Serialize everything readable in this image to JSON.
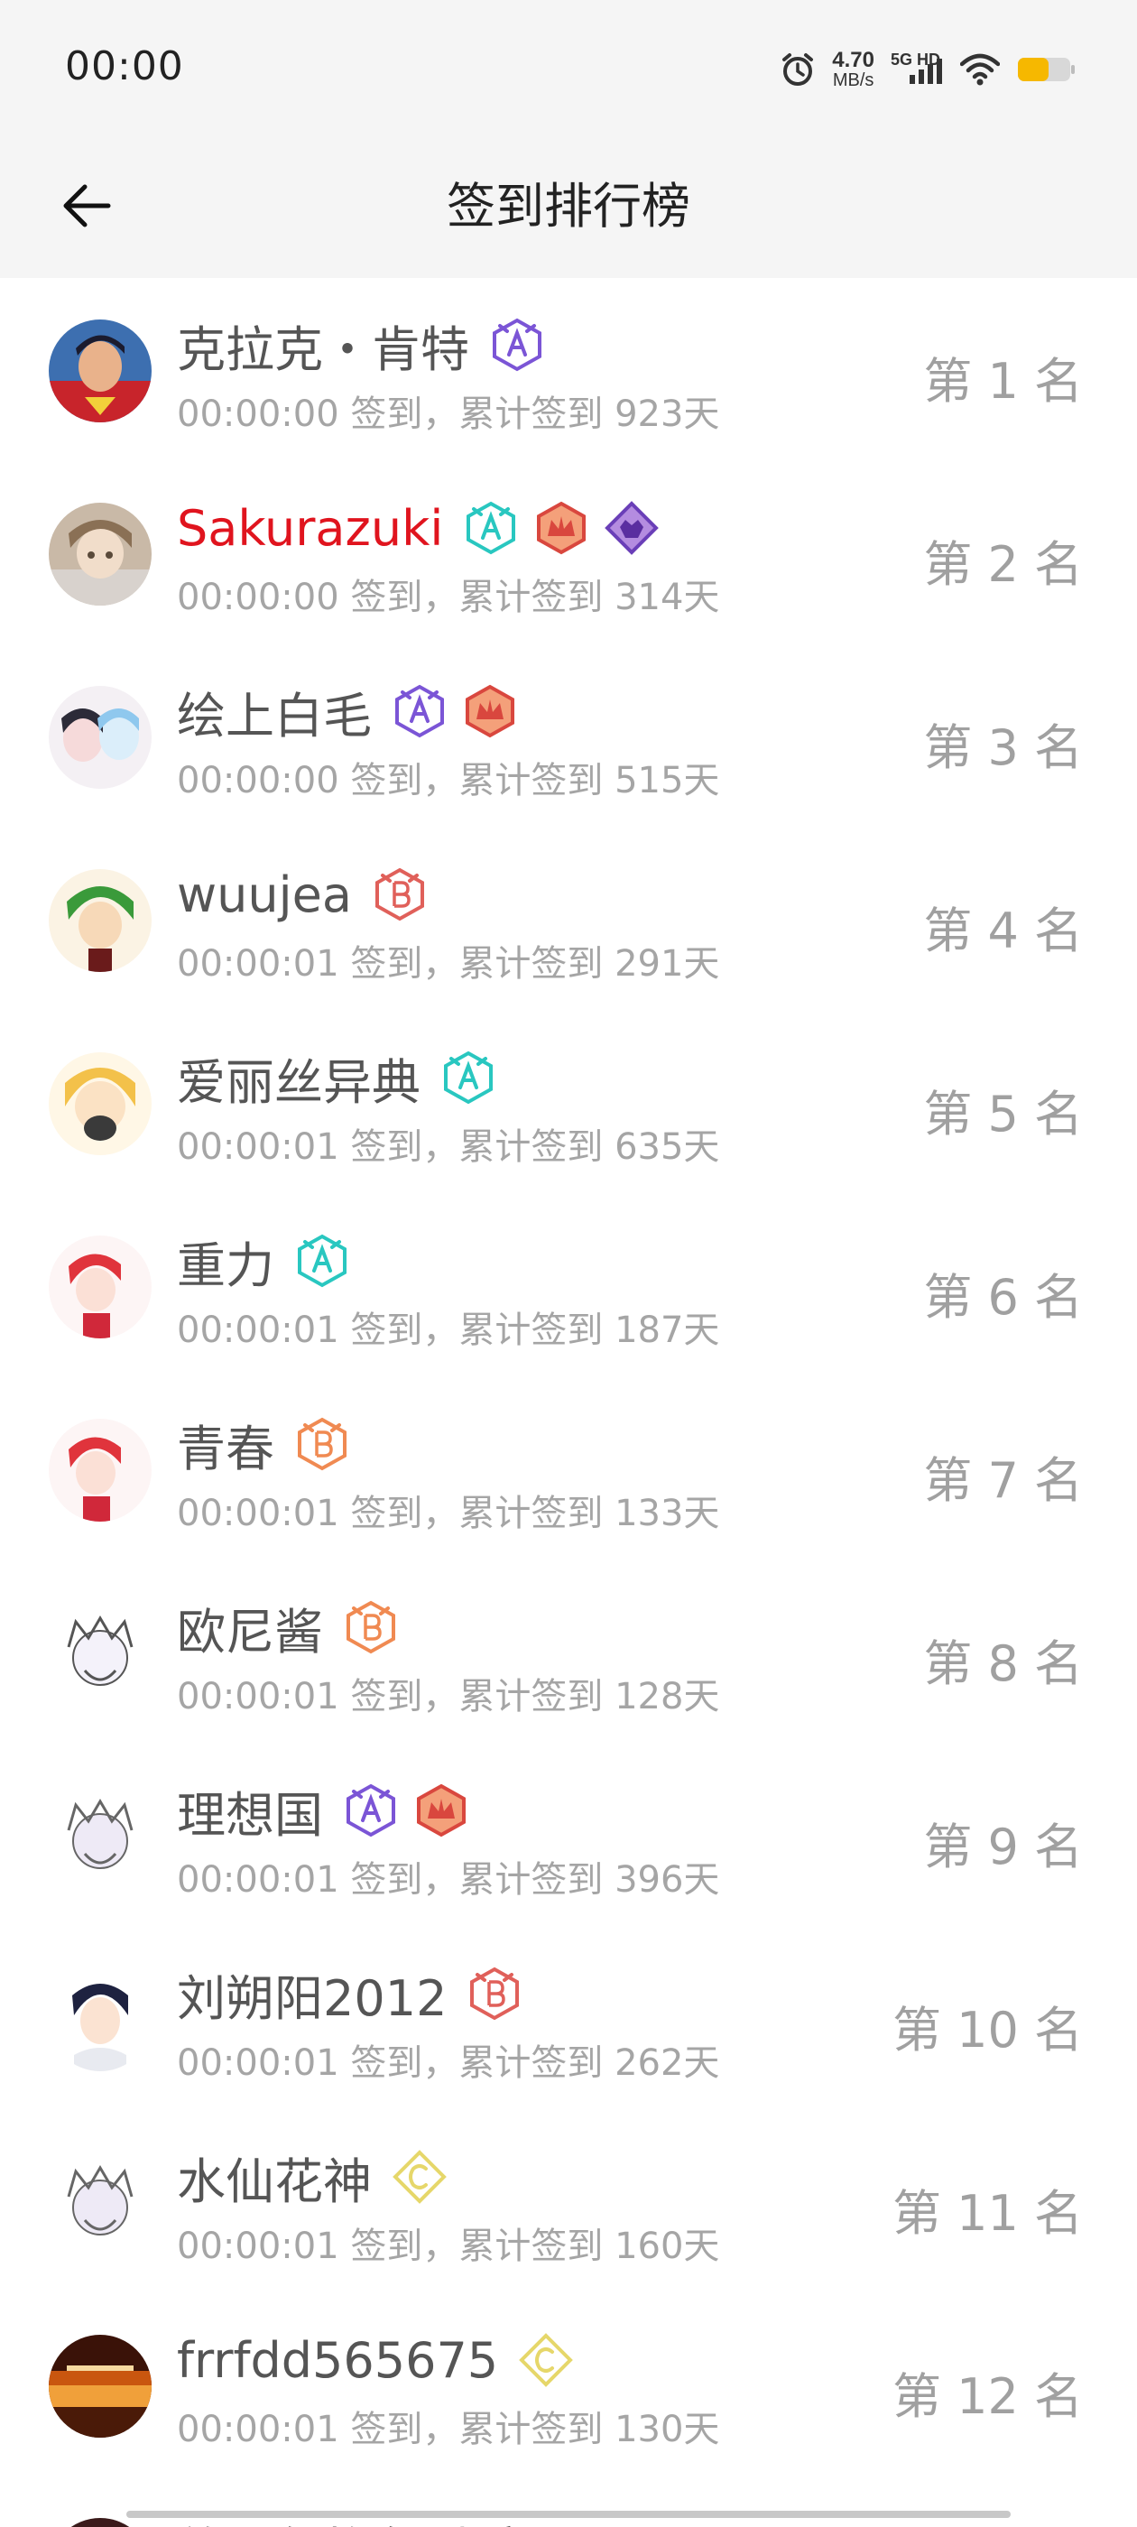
{
  "status_bar": {
    "time": "00:00",
    "speed_value": "4.70",
    "speed_unit": "MB/s",
    "network_label": "5G HD",
    "icons": [
      "alarm-icon",
      "signal-icon",
      "wifi-icon",
      "battery-icon"
    ],
    "battery_color": "#f6b800"
  },
  "header": {
    "title": "签到排行榜",
    "back_icon": "arrow-left-icon"
  },
  "colors": {
    "accent_red": "#e0141e",
    "muted_text": "#a5a5a5",
    "rank_text": "#a0a0a0",
    "badge_purple": "#7b55d6",
    "badge_teal": "#29c7c0",
    "badge_red": "#e0605a",
    "badge_orange": "#f08a52",
    "badge_yellow": "#e6d76a"
  },
  "rankings": [
    {
      "name": "克拉克・肯特",
      "detail": "00:00:00 签到，累计签到 923天",
      "rank": "第 1 名",
      "badges": [
        "purple-a-badge"
      ],
      "name_color": "default"
    },
    {
      "name": "Sakurazuki",
      "detail": "00:00:00 签到，累计签到 314天",
      "rank": "第 2 名",
      "badges": [
        "teal-a-badge",
        "red-crown-badge",
        "purple-gem-badge"
      ],
      "name_color": "red"
    },
    {
      "name": "绘上白毛",
      "detail": "00:00:00 签到，累计签到 515天",
      "rank": "第 3 名",
      "badges": [
        "purple-a-badge",
        "red-crown-badge"
      ],
      "name_color": "default"
    },
    {
      "name": "wuujea",
      "detail": "00:00:01 签到，累计签到 291天",
      "rank": "第 4 名",
      "badges": [
        "red-b-badge"
      ],
      "name_color": "default"
    },
    {
      "name": "爱丽丝异典",
      "detail": "00:00:01 签到，累计签到 635天",
      "rank": "第 5 名",
      "badges": [
        "teal-a-badge"
      ],
      "name_color": "default"
    },
    {
      "name": "重力",
      "detail": "00:00:01 签到，累计签到 187天",
      "rank": "第 6 名",
      "badges": [
        "teal-a-badge"
      ],
      "name_color": "default"
    },
    {
      "name": "青春",
      "detail": "00:00:01 签到，累计签到 133天",
      "rank": "第 7 名",
      "badges": [
        "orange-b-badge"
      ],
      "name_color": "default"
    },
    {
      "name": "欧尼酱",
      "detail": "00:00:01 签到，累计签到 128天",
      "rank": "第 8 名",
      "badges": [
        "orange-b-badge"
      ],
      "name_color": "default"
    },
    {
      "name": "理想国",
      "detail": "00:00:01 签到，累计签到 396天",
      "rank": "第 9 名",
      "badges": [
        "purple-a-badge",
        "red-crown-badge"
      ],
      "name_color": "default"
    },
    {
      "name": "刘朔阳2012",
      "detail": "00:00:01 签到，累计签到 262天",
      "rank": "第 10 名",
      "badges": [
        "red-b-badge"
      ],
      "name_color": "default"
    },
    {
      "name": "水仙花神",
      "detail": "00:00:01 签到，累计签到 160天",
      "rank": "第 11 名",
      "badges": [
        "yellow-c-badge"
      ],
      "name_color": "default"
    },
    {
      "name": "frrfdd565675",
      "detail": "00:00:01 签到，累计签到 130天",
      "rank": "第 12 名",
      "badges": [
        "yellow-c-badge"
      ],
      "name_color": "default"
    }
  ],
  "partial_row": {
    "name": "放上包格各型·良"
  }
}
